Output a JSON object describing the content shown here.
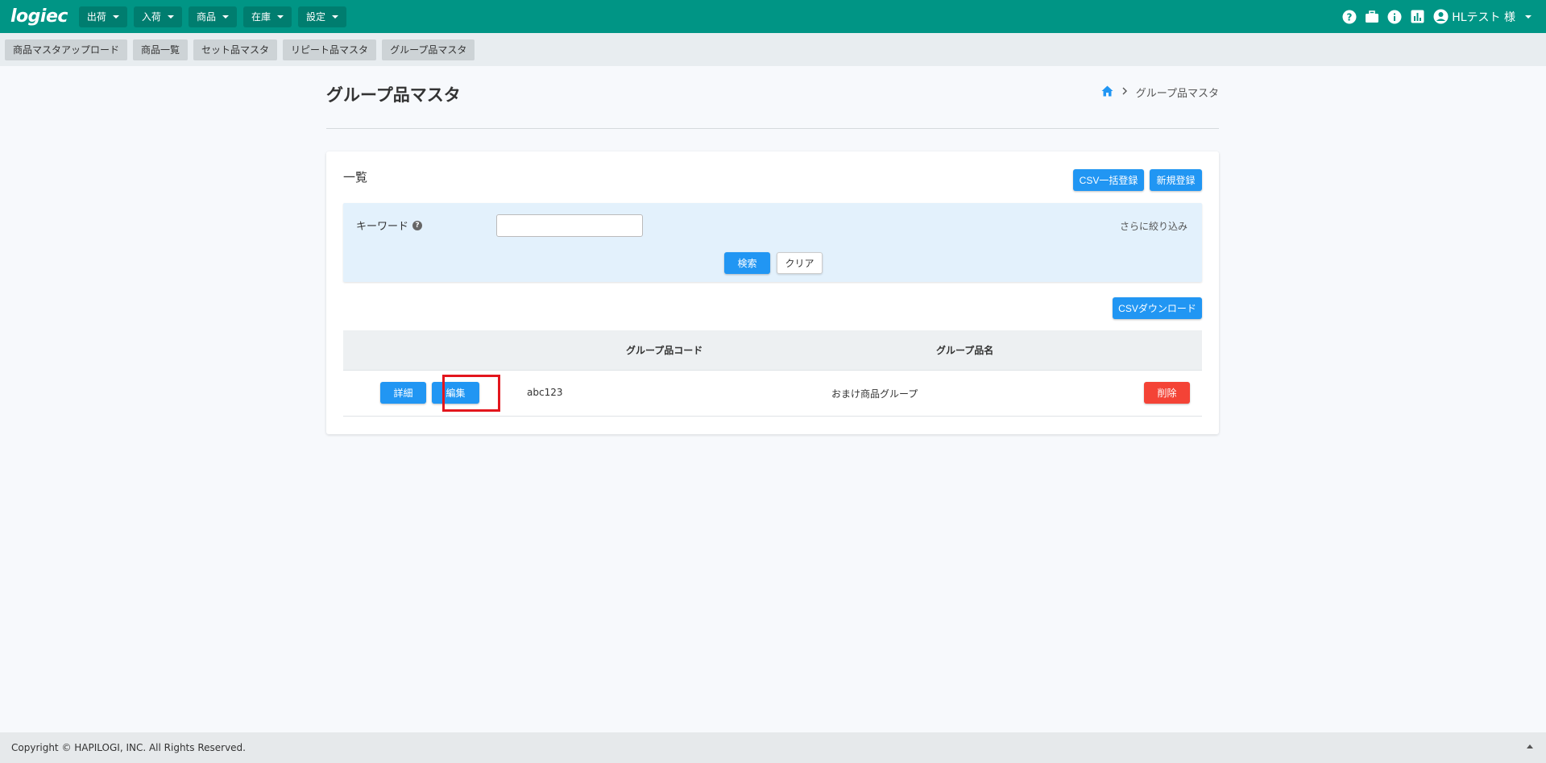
{
  "app": {
    "logo_text": "logiec"
  },
  "nav": {
    "items": [
      {
        "label": "出荷"
      },
      {
        "label": "入荷"
      },
      {
        "label": "商品"
      },
      {
        "label": "在庫"
      },
      {
        "label": "設定"
      }
    ],
    "user_label": "HLテスト 様"
  },
  "subnav": {
    "items": [
      {
        "label": "商品マスタアップロード"
      },
      {
        "label": "商品一覧"
      },
      {
        "label": "セット品マスタ"
      },
      {
        "label": "リピート品マスタ"
      },
      {
        "label": "グループ品マスタ"
      }
    ]
  },
  "page": {
    "title": "グループ品マスタ",
    "breadcrumb_current": "グループ品マスタ"
  },
  "card": {
    "title": "一覧",
    "csv_bulk_label": "CSV一括登録",
    "new_label": "新規登録",
    "csv_download_label": "CSVダウンロード"
  },
  "search": {
    "keyword_label": "キーワード",
    "keyword_value": "",
    "more_filter_label": "さらに絞り込み",
    "search_label": "検索",
    "clear_label": "クリア"
  },
  "table": {
    "columns": [
      "グループ品コード",
      "グループ品名"
    ],
    "rows": [
      {
        "detail_label": "詳細",
        "edit_label": "編集",
        "code": "abc123",
        "name": "おまけ商品グループ",
        "delete_label": "削除"
      }
    ]
  },
  "footer": {
    "copyright": "Copyright © HAPILOGI, INC. All Rights Reserved."
  },
  "colors": {
    "brand": "#009585",
    "primary": "#2196f3",
    "danger": "#f44336",
    "highlight": "#e3161d"
  }
}
